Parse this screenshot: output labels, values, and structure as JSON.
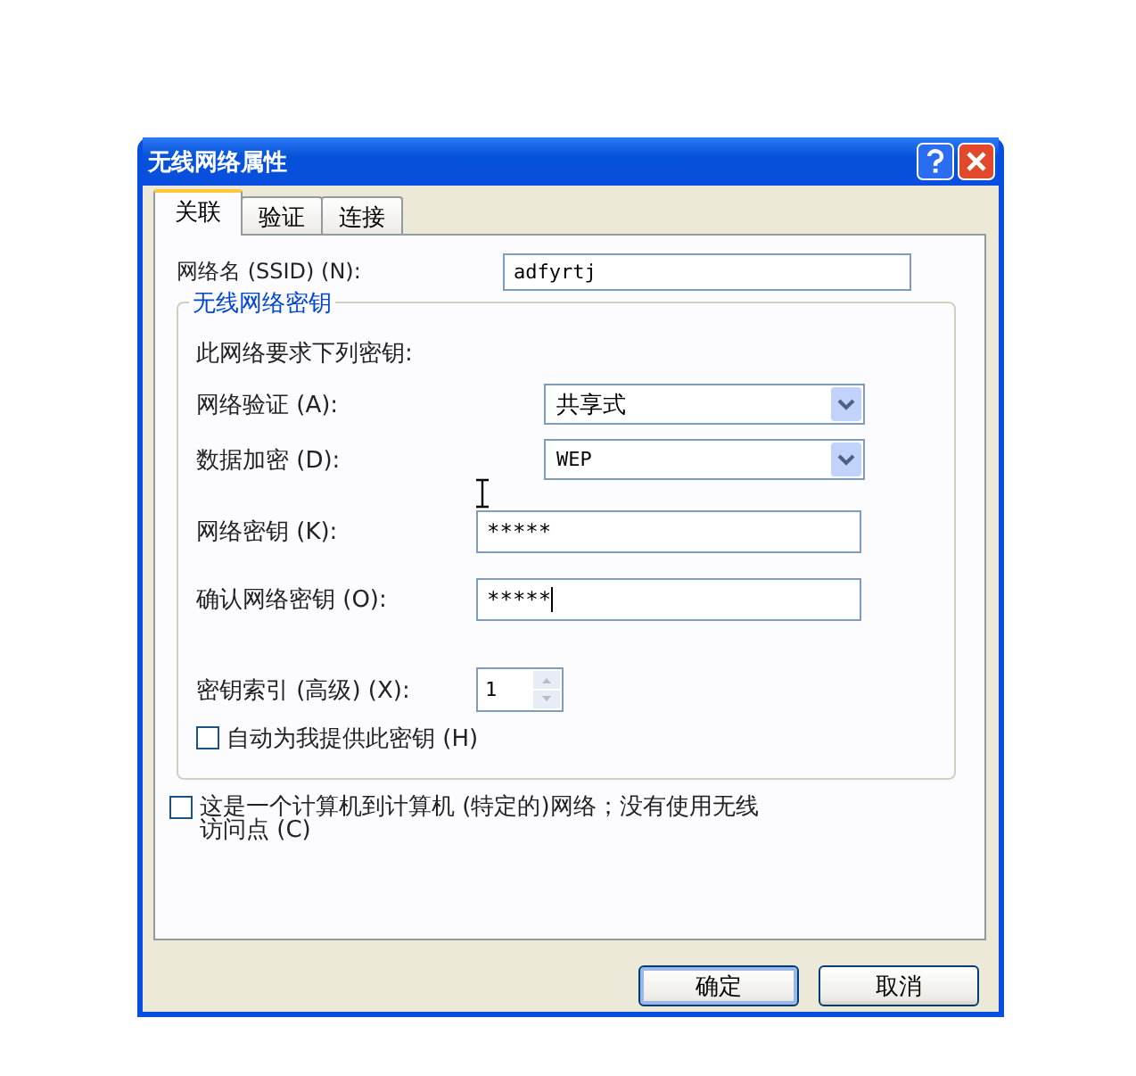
{
  "window": {
    "title": "无线网络属性"
  },
  "title_buttons": [
    {
      "kind": "help"
    },
    {
      "kind": "close"
    }
  ],
  "tabs": [
    {
      "label": "关联",
      "selected": true
    },
    {
      "label": "验证",
      "selected": false
    },
    {
      "label": "连接",
      "selected": false
    }
  ],
  "ssid": {
    "label": "网络名 (SSID) (N):",
    "value": "adfyrtj"
  },
  "key_group": {
    "title": "无线网络密钥",
    "note": "此网络要求下列密钥:",
    "rows": [
      {
        "kind": "select",
        "label": "网络验证 (A):",
        "value": "共享式"
      },
      {
        "kind": "select",
        "label": "数据加密 (D):",
        "value": "WEP"
      },
      {
        "kind": "password",
        "label": "网络密钥 (K):",
        "value": "*****",
        "focused": false
      },
      {
        "kind": "password",
        "label": "确认网络密钥 (O):",
        "value": "*****",
        "focused": true
      },
      {
        "kind": "spin",
        "label": "密钥索引 (高级) (X):",
        "value": "1"
      }
    ],
    "auto_key": {
      "label": "自动为我提供此密钥 (H)",
      "checked": false
    }
  },
  "adhoc": {
    "label": "这是一个计算机到计算机 (特定的)网络；没有使用无线访问点 (C)",
    "checked": false
  },
  "buttons": [
    {
      "label": "确定",
      "default": true
    },
    {
      "label": "取消",
      "default": false
    }
  ]
}
